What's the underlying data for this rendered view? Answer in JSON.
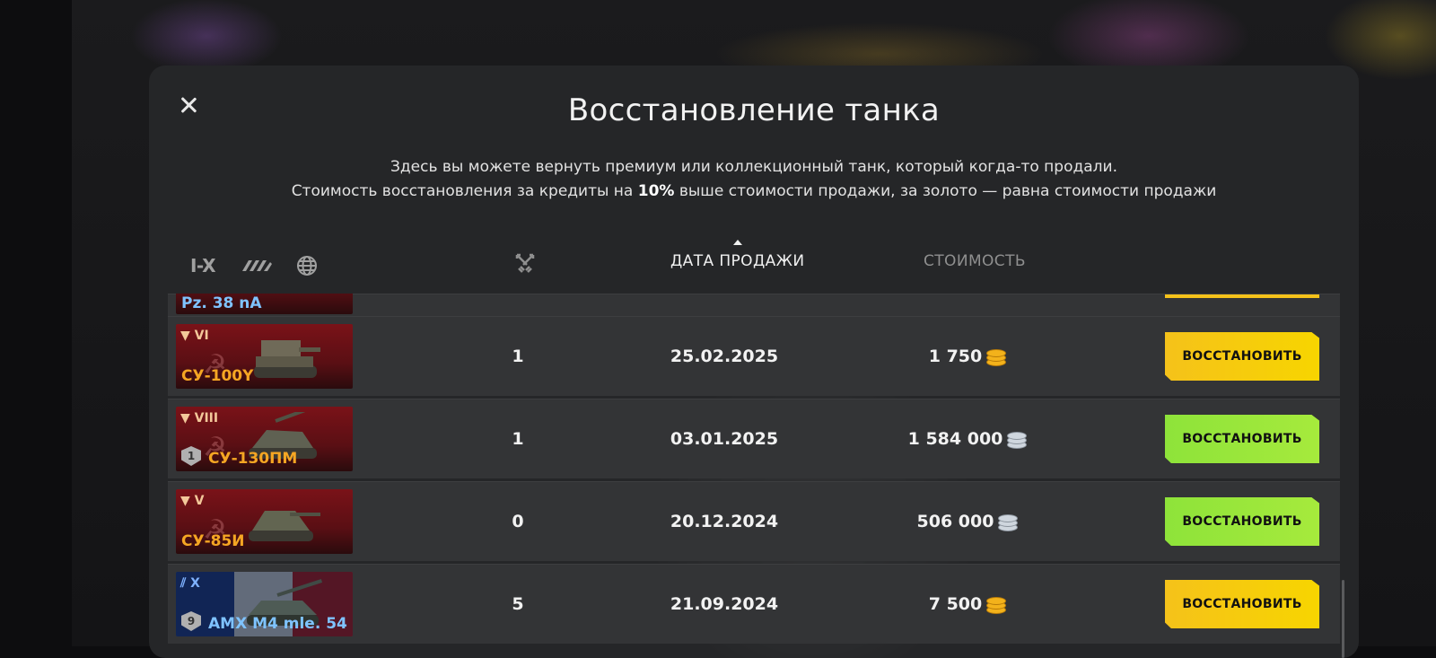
{
  "modal": {
    "title": "Восстановление танка",
    "desc_line1": "Здесь вы можете вернуть премиум или коллекционный танк, который когда-то продали.",
    "desc_line2_pre": "Стоимость восстановления за кредиты на ",
    "desc_line2_bold": "10%",
    "desc_line2_post": " выше стоимости продажи, за золото — равна стоимости продажи"
  },
  "filters": {
    "tier_label": "I-X",
    "type_icon": "tank-types-icon",
    "nation_icon": "globe-icon"
  },
  "columns": {
    "battles_icon": "crossed-swords-icon",
    "date": "ДАТА ПРОДАЖИ",
    "price": "СТОИМОСТЬ"
  },
  "rows": [
    {
      "name": "Pz. 38 nA",
      "partial": true
    },
    {
      "tier": "VI",
      "name": "СУ-100Y",
      "nation": "ussr",
      "battles": "1",
      "date": "25.02.2025",
      "price": "1 750",
      "currency": "gold",
      "button": "ВОССТАНОВИТЬ",
      "button_color": "#f5c21a"
    },
    {
      "tier": "VIII",
      "name": "СУ-130ПМ",
      "nation": "ussr",
      "mastery": "1",
      "battles": "1",
      "date": "03.01.2025",
      "price": "1 584 000",
      "currency": "silver",
      "button": "ВОССТАНОВИТЬ",
      "button_color": "#9be83b"
    },
    {
      "tier": "V",
      "name": "СУ-85И",
      "nation": "ussr",
      "battles": "0",
      "date": "20.12.2024",
      "price": "506 000",
      "currency": "silver",
      "button": "ВОССТАНОВИТЬ",
      "button_color": "#9be83b"
    },
    {
      "tier": "X",
      "name": "AMX M4 mle. 54",
      "nation": "france",
      "mastery": "9",
      "battles": "5",
      "date": "21.09.2024",
      "price": "7 500",
      "currency": "gold",
      "button": "ВОССТАНОВИТЬ",
      "button_color": "#f5c21a"
    }
  ]
}
